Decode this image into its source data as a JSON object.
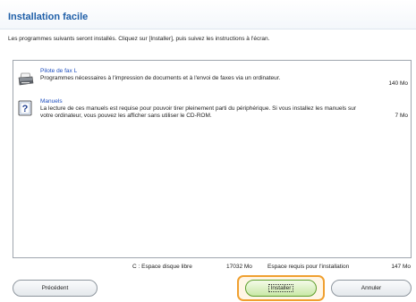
{
  "window": {
    "title": "Installation facile",
    "subtitle": "Les programmes suivants seront installés. Cliquez sur [Installer], puis suivez les instructions à l'écran."
  },
  "items": [
    {
      "name": "Pilote de fax L",
      "description": "Programmes nécessaires à l'impression de documents et à l'envoi de faxes via un ordinateur.",
      "size": "140 Mo",
      "icon": "printer-icon"
    },
    {
      "name": "Manuels",
      "description": "La lecture de ces manuels est requise pour pouvoir tirer pleinement parti du périphérique. Si vous installez les manuels sur votre ordinateur, vous pouvez les afficher sans utiliser le CD-ROM.",
      "size": "7 Mo",
      "icon": "help-manual-icon"
    }
  ],
  "footer": {
    "disk_label": "C : Espace disque libre",
    "disk_value": "17032 Mo",
    "required_label": "Espace requis pour l'installation",
    "required_value": "147 Mo"
  },
  "buttons": {
    "previous": "Précédent",
    "install": "Installer",
    "cancel": "Annuler"
  },
  "colors": {
    "title": "#1f5fa8",
    "item_name": "#1f4fbf",
    "install_highlight": "#f0a030"
  }
}
